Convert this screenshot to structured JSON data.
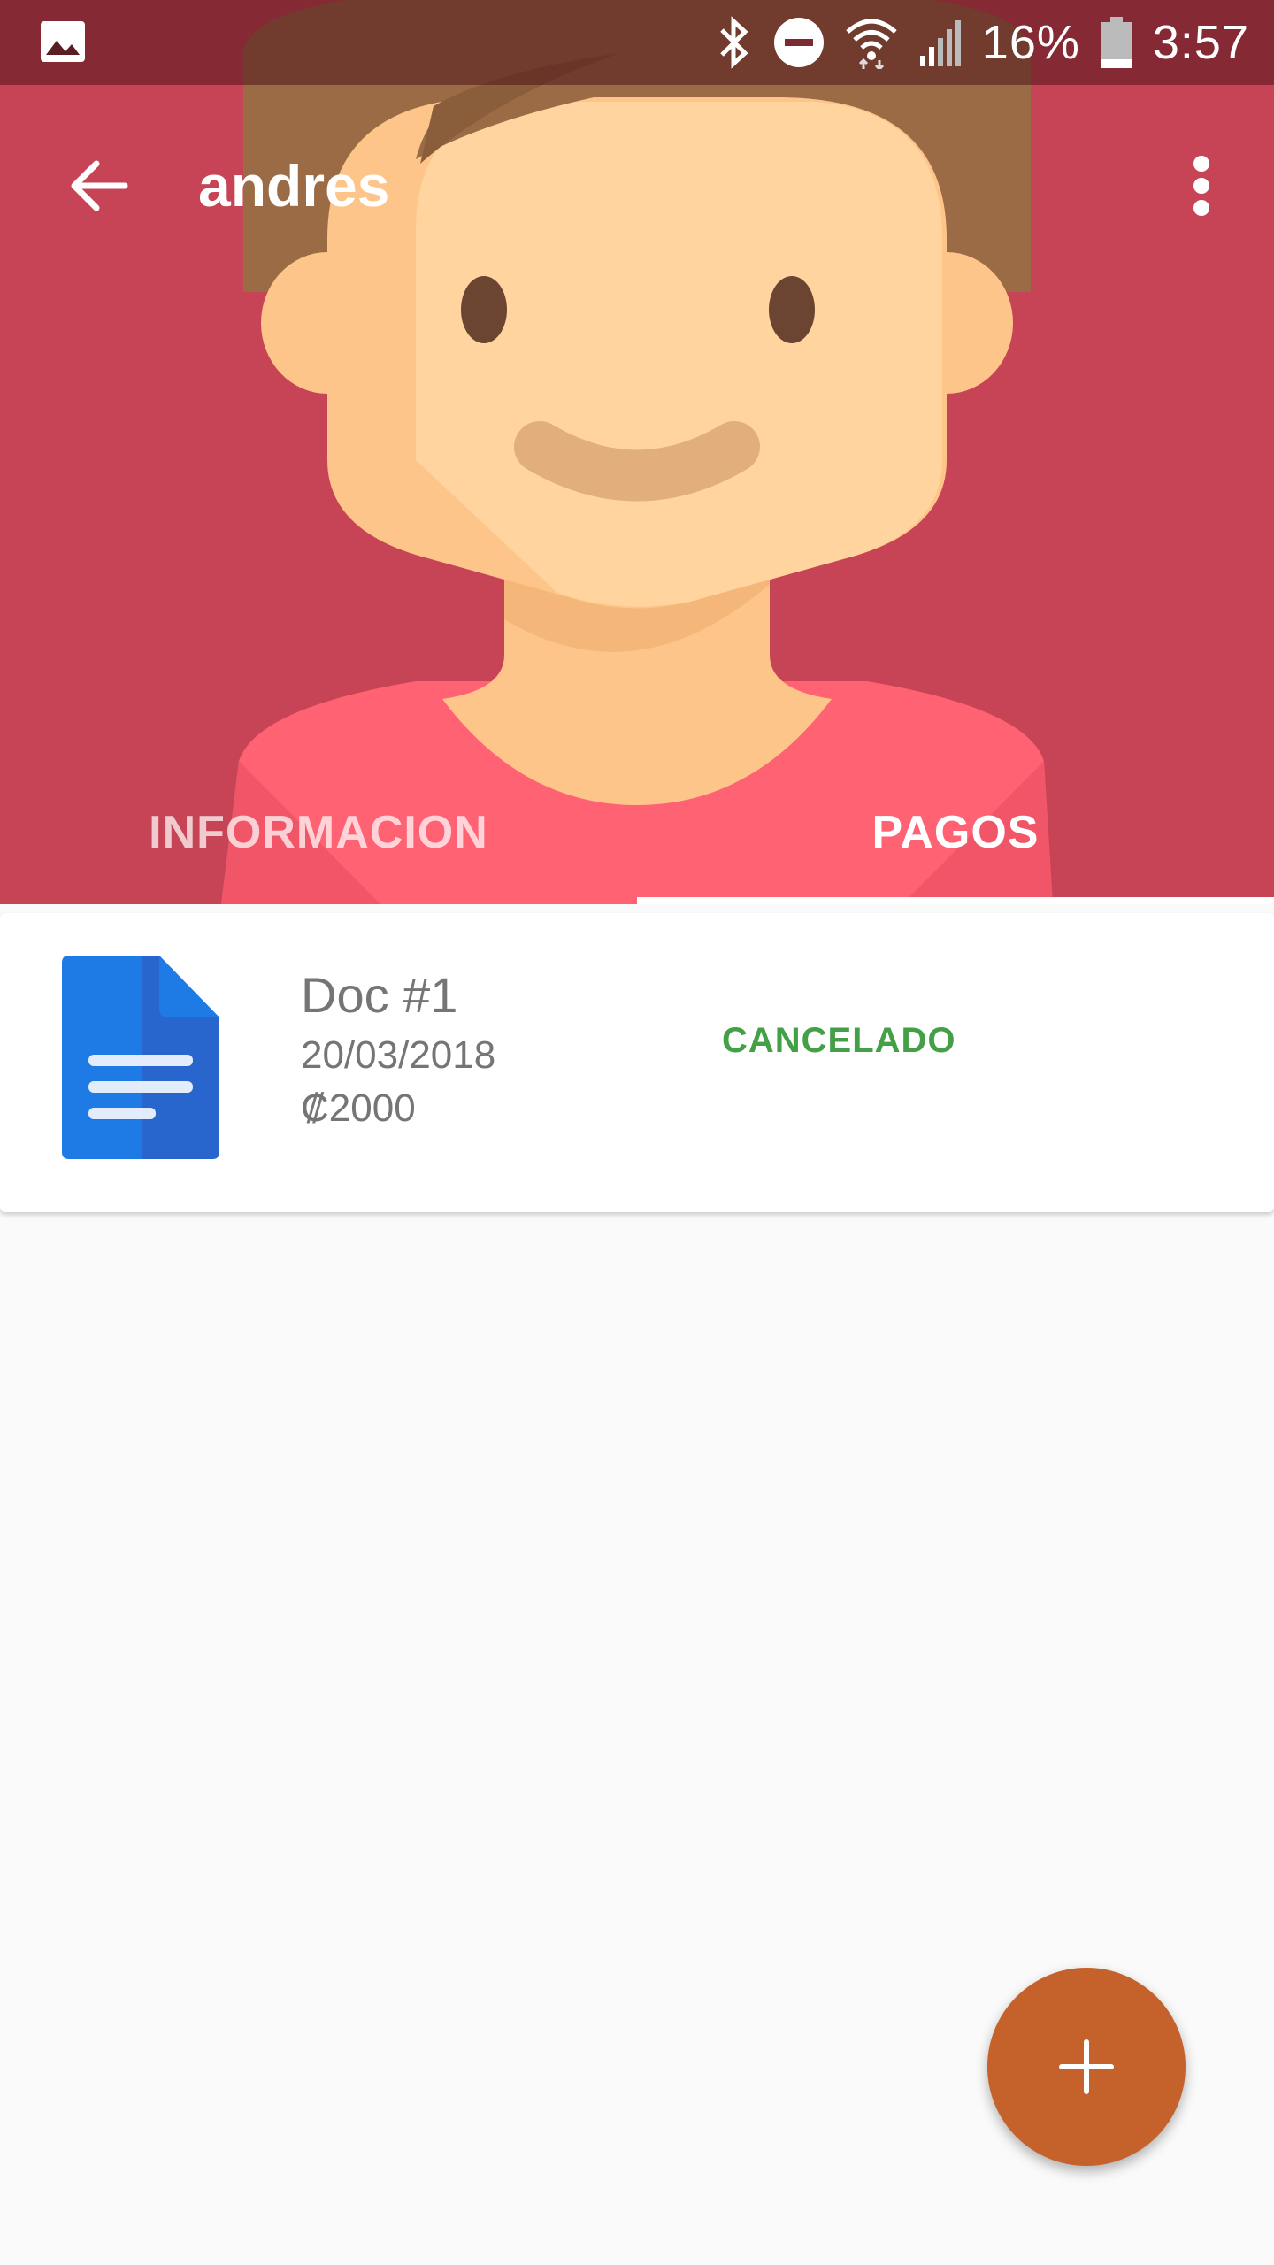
{
  "status_bar": {
    "battery_percent": "16%",
    "time": "3:57",
    "icons": [
      "gallery-icon",
      "bluetooth-icon",
      "do-not-disturb-icon",
      "wifi-icon",
      "signal-icon",
      "battery-icon"
    ]
  },
  "toolbar": {
    "title": "andres",
    "back_icon": "arrow-back-icon",
    "menu_icon": "more-vert-icon"
  },
  "tabs": [
    {
      "label": "INFORMACION",
      "selected": false
    },
    {
      "label": "PAGOS",
      "selected": true
    }
  ],
  "payments": [
    {
      "title": "Doc #1",
      "date": "20/03/2018",
      "amount": "₡2000",
      "status": "CANCELADO",
      "icon": "document-icon"
    }
  ],
  "fab": {
    "icon": "add-icon"
  },
  "colors": {
    "header": "#c64455",
    "status_ok": "#43a047",
    "fab": "#c5622b",
    "doc_icon": "#1e7be6"
  }
}
